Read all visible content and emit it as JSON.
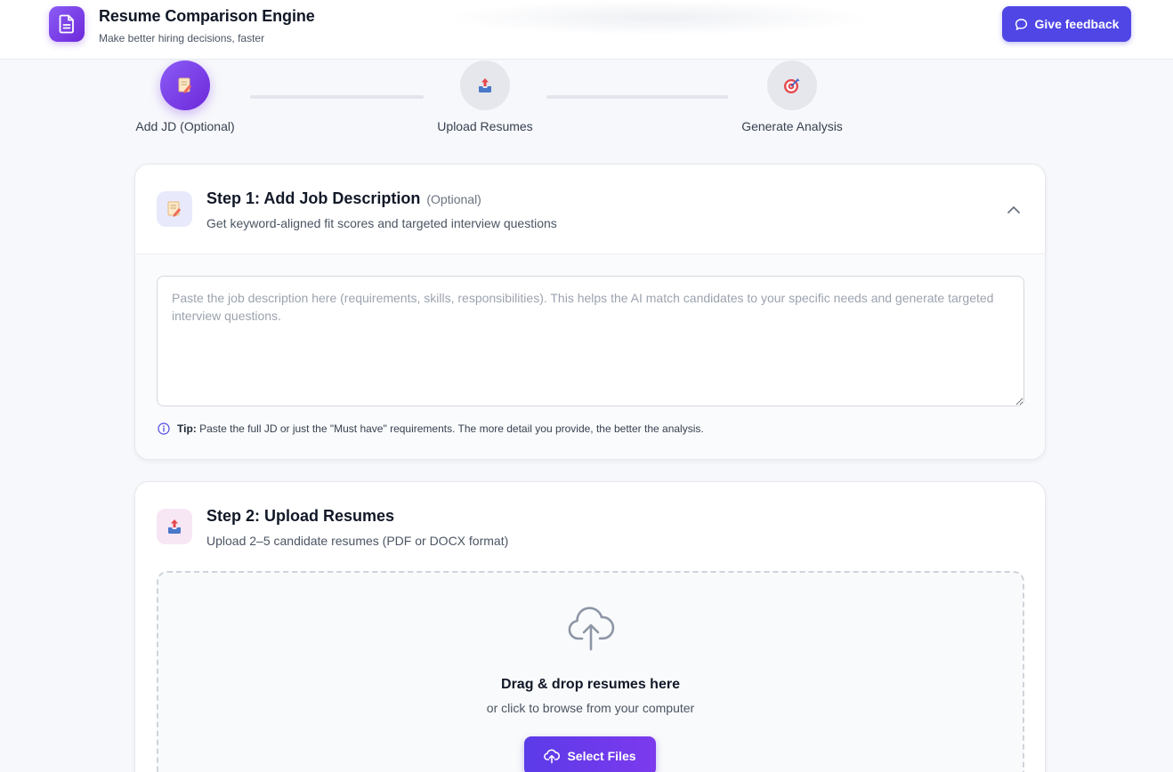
{
  "header": {
    "title": "Resume Comparison Engine",
    "subtitle": "Make better hiring decisions, faster",
    "feedback_label": "Give feedback"
  },
  "stepper": {
    "steps": [
      {
        "label": "Add JD (Optional)",
        "icon": "memo-icon",
        "active": true
      },
      {
        "label": "Upload Resumes",
        "icon": "inbox-upload-icon",
        "active": false
      },
      {
        "label": "Generate Analysis",
        "icon": "target-icon",
        "active": false
      }
    ]
  },
  "step1": {
    "title": "Step 1: Add Job Description",
    "optional": "(Optional)",
    "description": "Get keyword-aligned fit scores and targeted interview questions",
    "textarea_value": "",
    "textarea_placeholder": "Paste the job description here (requirements, skills, responsibilities). This helps the AI match candidates to your specific needs and generate targeted interview questions.",
    "tip_label": "Tip:",
    "tip_text": "Paste the full JD or just the \"Must have\" requirements. The more detail you provide, the better the analysis."
  },
  "step2": {
    "title": "Step 2: Upload Resumes",
    "description": "Upload 2–5 candidate resumes (PDF or DOCX format)",
    "drop_title": "Drag & drop resumes here",
    "drop_subtitle": "or click to browse from your computer",
    "select_label": "Select Files"
  },
  "colors": {
    "accent": "#4f46e5",
    "accent_purple": "#7c3aed",
    "background": "#f7f8fb"
  }
}
